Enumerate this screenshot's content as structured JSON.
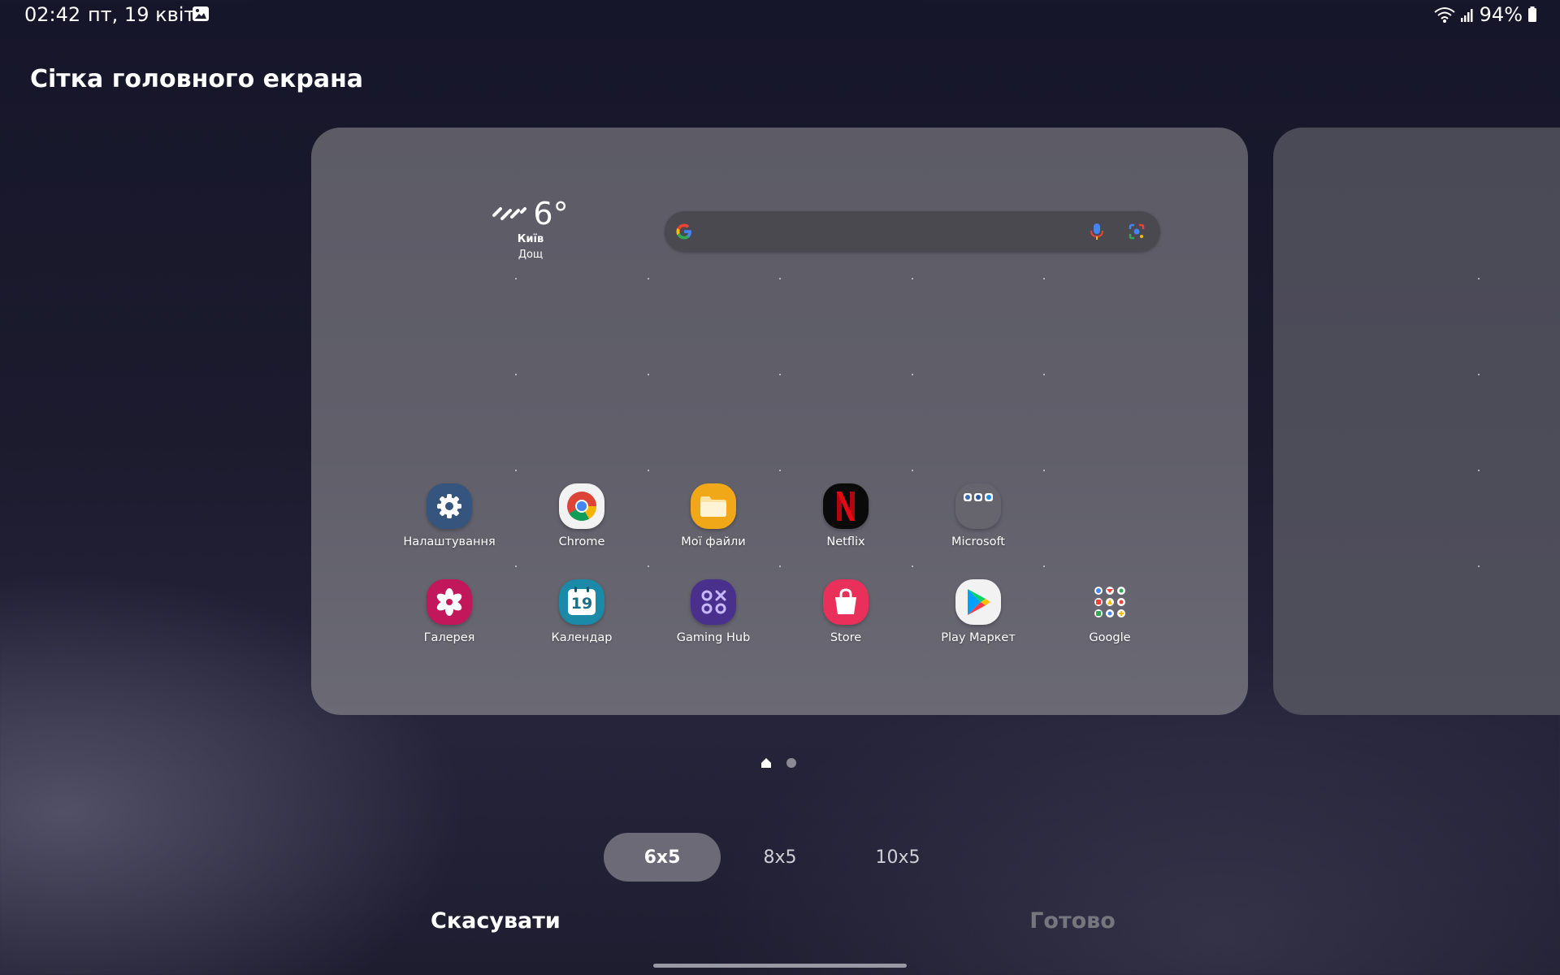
{
  "status_bar": {
    "time": "02:42",
    "date": "пт, 19 квіт.",
    "battery": "94%",
    "icons": [
      "gallery-icon",
      "wifi-icon",
      "signal-icon",
      "battery-icon"
    ]
  },
  "page_title": "Сітка головного екрана",
  "weather": {
    "temperature": "6°",
    "city": "Київ",
    "condition": "Дощ",
    "icon": "rain-icon"
  },
  "search": {
    "icons": [
      "google-g-icon",
      "mic-icon",
      "lens-icon"
    ]
  },
  "apps_row1": [
    {
      "label": "Налаштування",
      "icon": "settings-icon",
      "color": "#3a5a8a"
    },
    {
      "label": "Chrome",
      "icon": "chrome-icon",
      "color": "#f2f2f2"
    },
    {
      "label": "Мої файли",
      "icon": "folder-icon",
      "color": "#f0a818"
    },
    {
      "label": "Netflix",
      "icon": "netflix-icon",
      "color": "#0a0a0a"
    },
    {
      "label": "Microsoft",
      "icon": "folder-apps-icon",
      "color": "#6a6a72"
    }
  ],
  "apps_row2": [
    {
      "label": "Галерея",
      "icon": "gallery-flower-icon",
      "color": "#c2185b"
    },
    {
      "label": "Календар",
      "icon": "calendar-icon",
      "color": "#1e88a8",
      "day": "19"
    },
    {
      "label": "Gaming Hub",
      "icon": "gaming-hub-icon",
      "color": "#4a2a8a"
    },
    {
      "label": "Store",
      "icon": "store-bag-icon",
      "color": "#e8305a"
    },
    {
      "label": "Play Маркет",
      "icon": "play-store-icon",
      "color": "#f2f2f2"
    },
    {
      "label": "Google",
      "icon": "google-folder-icon",
      "color": "transparent"
    }
  ],
  "grid_options": [
    {
      "label": "6x5",
      "selected": true
    },
    {
      "label": "8x5",
      "selected": false
    },
    {
      "label": "10x5",
      "selected": false
    }
  ],
  "actions": {
    "cancel": "Скасувати",
    "done": "Готово"
  },
  "page_indicator": {
    "pages": 2,
    "current": 1
  }
}
